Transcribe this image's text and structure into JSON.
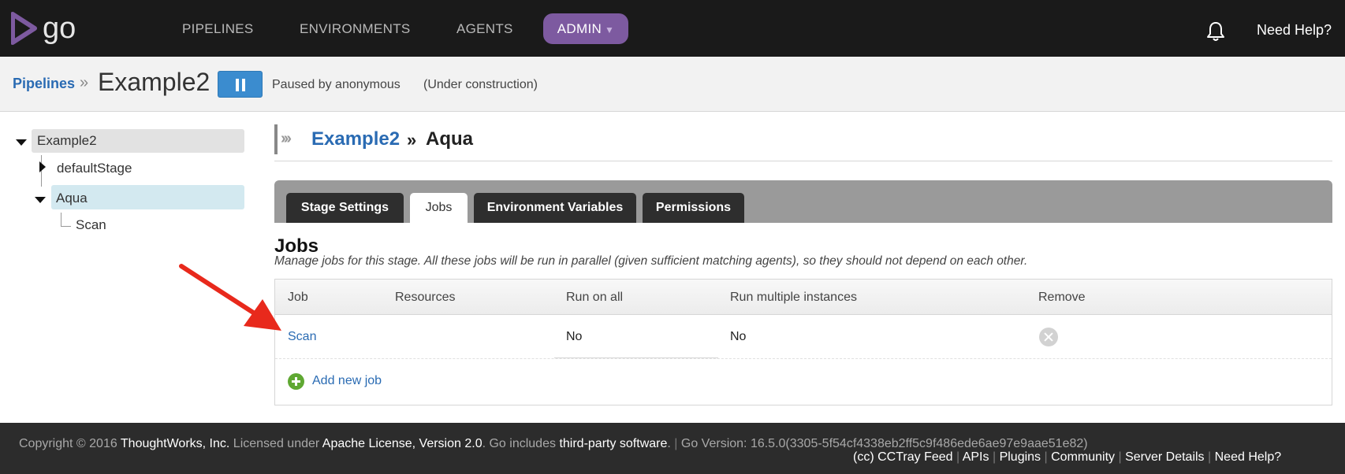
{
  "nav": {
    "logo_text": "go",
    "items": [
      "PIPELINES",
      "ENVIRONMENTS",
      "AGENTS"
    ],
    "admin_label": "ADMIN",
    "admin_caret": "▼",
    "bell_icon": "bell-icon",
    "need_help": "Need Help?"
  },
  "header": {
    "breadcrumb_link": "Pipelines",
    "breadcrumb_sep": "»",
    "pipeline_name": "Example2",
    "pause_icon": "pause-icon",
    "paused_by": "Paused by anonymous",
    "status": "(Under construction)"
  },
  "sidebar": {
    "pipeline": "Example2",
    "stages": [
      {
        "label": "defaultStage",
        "expanded": false
      },
      {
        "label": "Aqua",
        "expanded": true,
        "selected": true,
        "jobs": [
          "Scan"
        ]
      }
    ]
  },
  "main": {
    "stage_pipeline": "Example2",
    "stage_sep": "»",
    "stage_name": "Aqua",
    "tabs": [
      {
        "label": "Stage Settings",
        "active": false
      },
      {
        "label": "Jobs",
        "active": true
      },
      {
        "label": "Environment Variables",
        "active": false
      },
      {
        "label": "Permissions",
        "active": false
      }
    ],
    "section_title": "Jobs",
    "section_desc": "Manage jobs for this stage. All these jobs will be run in parallel (given sufficient matching agents), so they should not depend on each other.",
    "table": {
      "columns": [
        "Job",
        "Resources",
        "Run on all",
        "Run multiple instances",
        "Remove"
      ],
      "rows": [
        {
          "job": "Scan",
          "resources": "",
          "run_on_all": "No",
          "run_multiple": "No",
          "remove_icon": "remove-icon"
        }
      ]
    },
    "add_job_label": "Add new job"
  },
  "footer": {
    "copyright": "Copyright © 2016",
    "company": "ThoughtWorks, Inc.",
    "licensed": "Licensed under",
    "license": "Apache License, Version 2.0",
    "go_includes_prefix": ". Go includes",
    "third_party": "third-party software",
    "period": ".",
    "version_label": "Go Version: 16.5.0(3305-5f54cf4338eb2ff5c9f486ede6ae97e9aae51e82)",
    "links": [
      "(cc) CCTray Feed",
      "APIs",
      "Plugins",
      "Community",
      "Server Details",
      "Need Help?"
    ]
  },
  "colors": {
    "topbar": "#1a1a1a",
    "admin_purple": "#7d5aa0",
    "link_blue": "#2a6bb3",
    "pause_blue": "#3b8ccf",
    "selected_stage": "#d3e9f0",
    "add_green": "#5fa832",
    "annotation_arrow": "#e8291c"
  }
}
